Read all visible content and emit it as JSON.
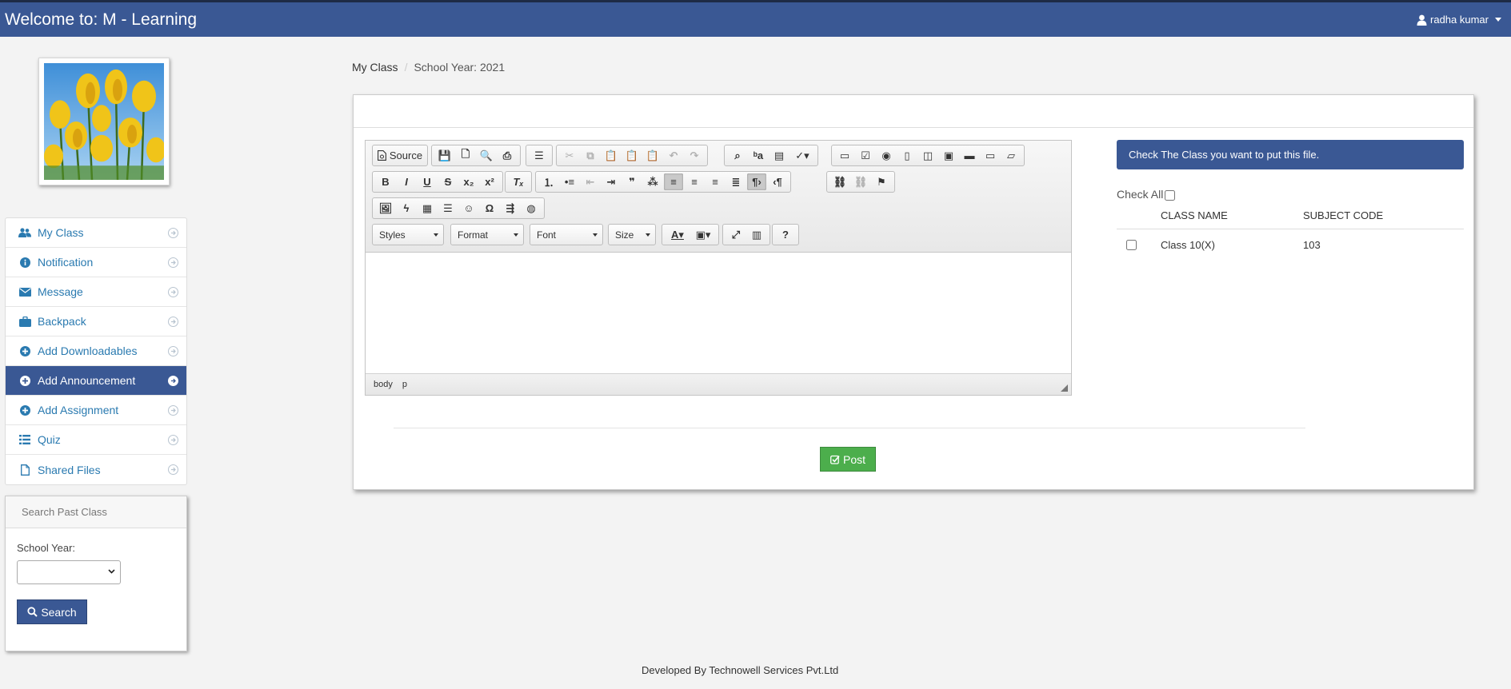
{
  "navbar": {
    "brand": "Welcome to: M - Learning",
    "user_name": "radha kumar"
  },
  "sidebar": {
    "items": [
      {
        "label": "My Class",
        "icon": "users-icon"
      },
      {
        "label": "Notification",
        "icon": "info-icon"
      },
      {
        "label": "Message",
        "icon": "envelope-icon"
      },
      {
        "label": "Backpack",
        "icon": "briefcase-icon"
      },
      {
        "label": "Add Downloadables",
        "icon": "plus-circle-icon"
      },
      {
        "label": "Add Announcement",
        "icon": "plus-circle-icon",
        "active": true
      },
      {
        "label": "Add Assignment",
        "icon": "plus-circle-icon"
      },
      {
        "label": "Quiz",
        "icon": "list-icon"
      },
      {
        "label": "Shared Files",
        "icon": "file-icon"
      }
    ],
    "search_panel": {
      "title": "Search Past Class",
      "label": "School Year:",
      "selected": "",
      "button_label": "Search"
    }
  },
  "breadcrumb": {
    "root": "My Class",
    "sep": "/",
    "current": "School Year: 2021"
  },
  "editor": {
    "source_label": "Source",
    "combos": {
      "styles": "Styles",
      "format": "Format",
      "font": "Font",
      "size": "Size"
    },
    "status_path": [
      "body",
      "p"
    ]
  },
  "class_panel": {
    "notice": "Check The Class you want to put this file.",
    "check_all_label": "Check All",
    "columns": [
      "CLASS NAME",
      "SUBJECT CODE"
    ],
    "rows": [
      {
        "class_name": "Class 10(X)",
        "subject_code": "103"
      }
    ]
  },
  "post_button": "Post",
  "footer": "Developed By Technowell Services Pvt.Ltd",
  "colors": {
    "primary": "#3a5894",
    "success": "#4cae4c",
    "link": "#2a7ab0"
  }
}
